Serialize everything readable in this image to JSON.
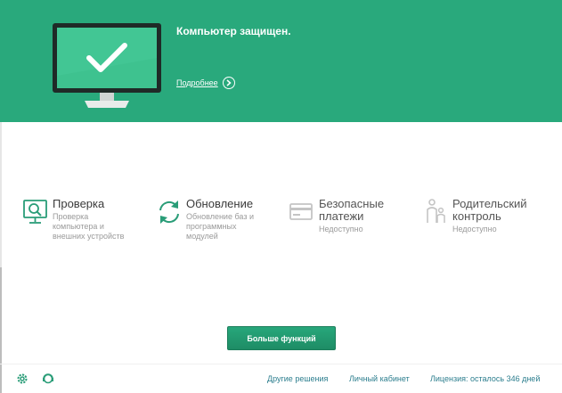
{
  "status": {
    "title": "Компьютер защищен.",
    "details_label": "Подробнее"
  },
  "tiles": [
    {
      "title": "Проверка",
      "subtitle": [
        "Проверка",
        "компьютера и",
        "внешних устройств"
      ],
      "icon": "scan-icon"
    },
    {
      "title": "Обновление",
      "subtitle": [
        "Обновление баз и",
        "программных",
        "модулей"
      ],
      "icon": "update-icon"
    },
    {
      "title": [
        "Безопасные",
        "платежи"
      ],
      "subtitle": [
        "Недоступно"
      ],
      "icon": "safe-money-icon"
    },
    {
      "title": [
        "Родительский",
        "контроль"
      ],
      "subtitle": [
        "Недоступно"
      ],
      "icon": "parental-control-icon"
    }
  ],
  "more_button": "Больше функций",
  "footer": {
    "links": [
      "Другие решения",
      "Личный кабинет",
      "Лицензия: осталось 346 дней"
    ],
    "icons": [
      "settings-icon",
      "support-icon"
    ]
  },
  "colors": {
    "accent": "#29a97c",
    "link": "#2c7e8e",
    "monitor_screen": "#3ec28f"
  }
}
